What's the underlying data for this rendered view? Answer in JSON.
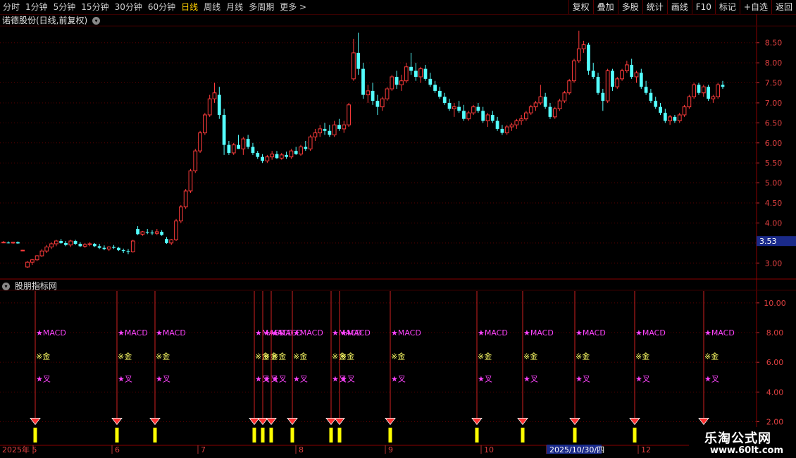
{
  "toolbar": {
    "periods": [
      "分时",
      "1分钟",
      "5分钟",
      "15分钟",
      "30分钟",
      "60分钟",
      "日线",
      "周线",
      "月线",
      "多周期",
      "更多 >"
    ],
    "active_period": "日线",
    "right_buttons": [
      "复权",
      "叠加",
      "多股",
      "统计",
      "画线",
      "F10",
      "标记",
      "+自选",
      "返回"
    ]
  },
  "chart_header": {
    "title": "诺德股份(日线,前复权)",
    "menu_icon": "chevron-down-icon"
  },
  "price_axis": {
    "ticks": [
      "8.50",
      "8.00",
      "7.50",
      "7.00",
      "6.50",
      "6.00",
      "5.50",
      "5.00",
      "4.50",
      "4.00",
      "3.50",
      "3.00"
    ],
    "current_price": "3.53"
  },
  "indicator_panel": {
    "title": "股朋指标网",
    "axis_ticks": [
      "10.00",
      "8.00",
      "6.00",
      "4.00",
      "2.00"
    ],
    "label_macd": "★MACD",
    "label_gold": "※金",
    "label_cross": "★叉"
  },
  "date_axis": {
    "labels": [
      "2025年 5",
      "6",
      "7",
      "8",
      "9",
      "10",
      "2025/10/30/四",
      "12"
    ]
  },
  "watermark": {
    "title": "乐淘公式网",
    "url": "www.60lt.com"
  },
  "colors": {
    "up": "#ff3b3b",
    "down": "#54ffff",
    "grid": "#5a0000",
    "signal_bar": "#ffff00",
    "magenta": "#ff44ff",
    "gold": "#ffff66"
  },
  "chart_data": {
    "type": "candlestick",
    "y_range": [
      2.6,
      8.9
    ],
    "candles": [
      [
        3.52,
        3.55,
        3.5,
        3.52
      ],
      [
        3.51,
        3.54,
        3.49,
        3.5
      ],
      [
        3.5,
        3.53,
        3.48,
        3.52
      ],
      [
        3.52,
        3.54,
        3.48,
        3.49
      ],
      [
        3.31,
        3.33,
        3.3,
        3.32
      ],
      [
        2.9,
        3.05,
        2.88,
        3.02
      ],
      [
        3.02,
        3.1,
        2.95,
        3.08
      ],
      [
        3.08,
        3.2,
        3.05,
        3.18
      ],
      [
        3.18,
        3.35,
        3.15,
        3.3
      ],
      [
        3.3,
        3.45,
        3.25,
        3.4
      ],
      [
        3.4,
        3.52,
        3.35,
        3.48
      ],
      [
        3.48,
        3.58,
        3.42,
        3.55
      ],
      [
        3.55,
        3.6,
        3.48,
        3.5
      ],
      [
        3.5,
        3.55,
        3.42,
        3.45
      ],
      [
        3.45,
        3.58,
        3.4,
        3.55
      ],
      [
        3.55,
        3.58,
        3.45,
        3.48
      ],
      [
        3.48,
        3.52,
        3.4,
        3.42
      ],
      [
        3.42,
        3.5,
        3.38,
        3.46
      ],
      [
        3.46,
        3.52,
        3.42,
        3.48
      ],
      [
        3.48,
        3.5,
        3.4,
        3.42
      ],
      [
        3.42,
        3.48,
        3.35,
        3.38
      ],
      [
        3.38,
        3.44,
        3.32,
        3.35
      ],
      [
        3.35,
        3.42,
        3.3,
        3.4
      ],
      [
        3.4,
        3.45,
        3.35,
        3.38
      ],
      [
        3.38,
        3.4,
        3.3,
        3.32
      ],
      [
        3.32,
        3.36,
        3.25,
        3.3
      ],
      [
        3.3,
        3.35,
        3.22,
        3.28
      ],
      [
        3.28,
        3.58,
        3.26,
        3.55
      ],
      [
        3.85,
        3.92,
        3.7,
        3.72
      ],
      [
        3.72,
        3.8,
        3.68,
        3.78
      ],
      [
        3.78,
        3.85,
        3.72,
        3.76
      ],
      [
        3.76,
        3.82,
        3.7,
        3.74
      ],
      [
        3.74,
        3.85,
        3.7,
        3.78
      ],
      [
        3.78,
        3.82,
        3.68,
        3.7
      ],
      [
        3.6,
        3.65,
        3.48,
        3.5
      ],
      [
        3.5,
        3.6,
        3.45,
        3.58
      ],
      [
        3.58,
        4.1,
        3.55,
        4.05
      ],
      [
        4.05,
        4.45,
        4.0,
        4.4
      ],
      [
        4.4,
        4.85,
        4.35,
        4.8
      ],
      [
        4.8,
        5.35,
        4.75,
        5.3
      ],
      [
        5.3,
        5.85,
        5.25,
        5.8
      ],
      [
        5.8,
        6.3,
        5.75,
        6.25
      ],
      [
        6.25,
        6.75,
        6.2,
        6.7
      ],
      [
        6.7,
        7.2,
        6.65,
        7.1
      ],
      [
        7.1,
        7.5,
        7.0,
        7.25
      ],
      [
        7.2,
        7.4,
        6.6,
        6.7
      ],
      [
        6.7,
        6.85,
        5.7,
        5.95
      ],
      [
        5.95,
        6.05,
        5.7,
        5.75
      ],
      [
        5.75,
        6.0,
        5.7,
        5.95
      ],
      [
        5.95,
        6.2,
        5.85,
        5.85
      ],
      [
        5.85,
        6.15,
        5.7,
        6.1
      ],
      [
        6.1,
        6.2,
        5.85,
        5.9
      ],
      [
        5.9,
        6.0,
        5.7,
        5.75
      ],
      [
        5.75,
        5.8,
        5.6,
        5.65
      ],
      [
        5.65,
        5.72,
        5.5,
        5.55
      ],
      [
        5.55,
        5.7,
        5.5,
        5.65
      ],
      [
        5.65,
        5.8,
        5.58,
        5.72
      ],
      [
        5.72,
        5.8,
        5.6,
        5.62
      ],
      [
        5.62,
        5.75,
        5.58,
        5.7
      ],
      [
        5.7,
        5.78,
        5.6,
        5.65
      ],
      [
        5.65,
        5.85,
        5.6,
        5.8
      ],
      [
        5.8,
        5.9,
        5.7,
        5.72
      ],
      [
        5.72,
        5.95,
        5.68,
        5.9
      ],
      [
        5.9,
        6.05,
        5.8,
        5.85
      ],
      [
        5.85,
        6.2,
        5.8,
        6.15
      ],
      [
        6.15,
        6.35,
        6.05,
        6.25
      ],
      [
        6.25,
        6.45,
        6.15,
        6.35
      ],
      [
        6.35,
        6.5,
        6.2,
        6.3
      ],
      [
        6.3,
        6.45,
        6.15,
        6.2
      ],
      [
        6.2,
        6.55,
        6.15,
        6.45
      ],
      [
        6.45,
        6.6,
        6.3,
        6.35
      ],
      [
        6.35,
        6.55,
        6.25,
        6.45
      ],
      [
        6.45,
        7.0,
        6.4,
        6.95
      ],
      [
        7.6,
        8.6,
        7.55,
        8.25
      ],
      [
        8.25,
        8.75,
        7.7,
        7.85
      ],
      [
        7.85,
        8.0,
        7.1,
        7.2
      ],
      [
        7.2,
        7.45,
        7.0,
        7.3
      ],
      [
        7.3,
        7.5,
        6.95,
        7.05
      ],
      [
        7.05,
        7.2,
        6.7,
        6.9
      ],
      [
        6.9,
        7.15,
        6.8,
        7.1
      ],
      [
        7.1,
        7.4,
        7.05,
        7.35
      ],
      [
        7.35,
        7.7,
        7.3,
        7.65
      ],
      [
        7.65,
        7.8,
        7.35,
        7.45
      ],
      [
        7.45,
        7.7,
        7.3,
        7.55
      ],
      [
        7.55,
        8.0,
        7.5,
        7.9
      ],
      [
        7.9,
        8.25,
        7.7,
        7.8
      ],
      [
        7.8,
        8.0,
        7.55,
        7.65
      ],
      [
        7.65,
        7.9,
        7.5,
        7.85
      ],
      [
        7.85,
        7.95,
        7.55,
        7.6
      ],
      [
        7.6,
        7.75,
        7.4,
        7.45
      ],
      [
        7.45,
        7.55,
        7.25,
        7.3
      ],
      [
        7.3,
        7.4,
        7.1,
        7.15
      ],
      [
        7.15,
        7.25,
        6.95,
        7.0
      ],
      [
        7.0,
        7.1,
        6.8,
        6.85
      ],
      [
        6.85,
        7.0,
        6.65,
        6.9
      ],
      [
        6.9,
        7.05,
        6.75,
        6.8
      ],
      [
        6.8,
        6.95,
        6.55,
        6.6
      ],
      [
        6.6,
        6.8,
        6.55,
        6.75
      ],
      [
        6.75,
        6.95,
        6.7,
        6.9
      ],
      [
        6.9,
        7.0,
        6.75,
        6.8
      ],
      [
        6.8,
        6.9,
        6.5,
        6.55
      ],
      [
        6.55,
        6.75,
        6.4,
        6.7
      ],
      [
        6.7,
        6.8,
        6.5,
        6.55
      ],
      [
        6.55,
        6.65,
        6.3,
        6.35
      ],
      [
        6.35,
        6.45,
        6.2,
        6.25
      ],
      [
        6.25,
        6.45,
        6.2,
        6.4
      ],
      [
        6.4,
        6.5,
        6.3,
        6.45
      ],
      [
        6.45,
        6.6,
        6.35,
        6.55
      ],
      [
        6.55,
        6.7,
        6.45,
        6.6
      ],
      [
        6.6,
        6.8,
        6.55,
        6.75
      ],
      [
        6.75,
        6.95,
        6.7,
        6.9
      ],
      [
        6.9,
        7.05,
        6.8,
        7.0
      ],
      [
        7.0,
        7.45,
        6.95,
        7.15
      ],
      [
        7.15,
        7.25,
        6.85,
        6.9
      ],
      [
        6.9,
        7.0,
        6.6,
        6.65
      ],
      [
        6.65,
        6.9,
        6.6,
        6.85
      ],
      [
        6.85,
        7.1,
        6.8,
        7.05
      ],
      [
        7.05,
        7.3,
        7.0,
        7.25
      ],
      [
        7.25,
        7.6,
        7.2,
        7.55
      ],
      [
        7.55,
        8.1,
        7.5,
        8.05
      ],
      [
        8.05,
        8.8,
        8.0,
        8.35
      ],
      [
        8.35,
        8.55,
        8.25,
        8.45
      ],
      [
        8.45,
        8.5,
        7.7,
        7.8
      ],
      [
        7.8,
        8.0,
        7.6,
        7.65
      ],
      [
        7.65,
        7.75,
        7.2,
        7.25
      ],
      [
        7.25,
        7.35,
        6.8,
        7.05
      ],
      [
        7.05,
        7.85,
        7.0,
        7.8
      ],
      [
        7.8,
        7.85,
        7.3,
        7.4
      ],
      [
        7.4,
        7.65,
        7.35,
        7.6
      ],
      [
        7.6,
        7.85,
        7.55,
        7.8
      ],
      [
        7.8,
        8.05,
        7.75,
        7.95
      ],
      [
        7.95,
        8.1,
        7.6,
        7.65
      ],
      [
        7.65,
        7.8,
        7.5,
        7.75
      ],
      [
        7.75,
        7.85,
        7.35,
        7.4
      ],
      [
        7.4,
        7.55,
        7.2,
        7.25
      ],
      [
        7.25,
        7.35,
        7.0,
        7.05
      ],
      [
        7.05,
        7.15,
        6.85,
        6.9
      ],
      [
        6.9,
        7.0,
        6.7,
        6.75
      ],
      [
        6.75,
        6.85,
        6.5,
        6.55
      ],
      [
        6.55,
        6.7,
        6.45,
        6.65
      ],
      [
        6.65,
        6.7,
        6.5,
        6.55
      ],
      [
        6.55,
        6.75,
        6.5,
        6.7
      ],
      [
        6.7,
        6.95,
        6.65,
        6.9
      ],
      [
        6.9,
        7.2,
        6.85,
        7.15
      ],
      [
        7.15,
        7.5,
        7.1,
        7.45
      ],
      [
        7.45,
        7.5,
        7.2,
        7.25
      ],
      [
        7.25,
        7.45,
        7.15,
        7.4
      ],
      [
        7.4,
        7.45,
        7.05,
        7.1
      ],
      [
        7.1,
        7.2,
        7.0,
        7.15
      ],
      [
        7.15,
        7.5,
        7.1,
        7.45
      ],
      [
        7.45,
        7.55,
        7.35,
        7.4
      ]
    ],
    "indicator_signals": [
      50,
      166,
      220,
      361,
      373,
      385,
      415,
      470,
      482,
      554,
      677,
      742,
      816,
      901,
      999
    ]
  }
}
